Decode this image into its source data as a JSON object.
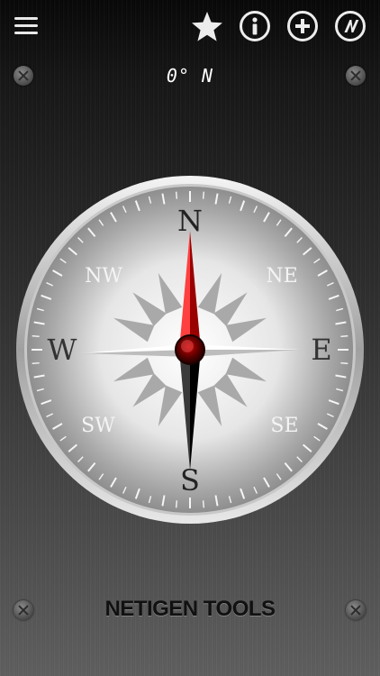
{
  "header": {
    "heading_degrees": "0°",
    "heading_direction": "N"
  },
  "icons": {
    "menu": "hamburger-icon",
    "favorite": "star-icon",
    "info": "info-icon",
    "add": "plus-icon",
    "app": "netigen-logo-icon"
  },
  "compass": {
    "heading_deg": 0,
    "cardinals": {
      "north": "N",
      "east": "E",
      "south": "S",
      "west": "W"
    },
    "intercardinals": {
      "northeast": "NE",
      "southeast": "SE",
      "southwest": "SW",
      "northwest": "NW"
    }
  },
  "footer": {
    "brand": "NETIGEN TOOLS"
  },
  "colors": {
    "needle_north": "#cc0000",
    "needle_south": "#111111",
    "dial_face": "#f2f2f2",
    "icons": "#ececec"
  }
}
